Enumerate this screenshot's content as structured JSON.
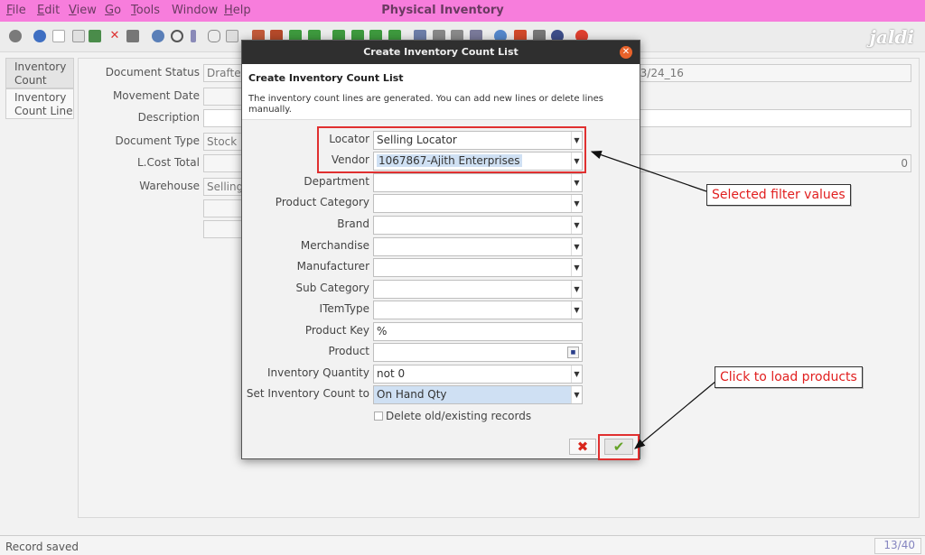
{
  "menubar": {
    "items": [
      {
        "pre": "",
        "u": "F",
        "post": "ile"
      },
      {
        "pre": "",
        "u": "E",
        "post": "dit"
      },
      {
        "pre": "",
        "u": "V",
        "post": "iew"
      },
      {
        "pre": "",
        "u": "G",
        "post": "o"
      },
      {
        "pre": "",
        "u": "T",
        "post": "ools"
      },
      {
        "pre": "Window",
        "u": "",
        "post": ""
      },
      {
        "pre": "",
        "u": "H",
        "post": "elp"
      }
    ],
    "title": "Physical Inventory"
  },
  "toolbar": {
    "logo_text": "jaldi",
    "icons": [
      "undo-icon",
      "help-icon",
      "new-icon",
      "copy-icon",
      "save-icon",
      "delete-icon",
      "grid-icon",
      "refresh-icon",
      "find-icon",
      "attachment-icon",
      "chat-icon",
      "history-icon",
      "home-icon",
      "parent-icon",
      "previous-icon",
      "next-icon",
      "first-icon",
      "up-icon",
      "down-icon",
      "last-icon",
      "report-icon",
      "archive-icon",
      "print-icon",
      "zoom-icon",
      "workflow-icon",
      "product-info-icon",
      "process-icon",
      "exit-icon"
    ]
  },
  "tabs": [
    {
      "label": "Inventory Count",
      "active": true
    },
    {
      "label": "Inventory Count Line",
      "active": false
    }
  ],
  "form": {
    "document_status_label": "Document Status",
    "document_status_value": "Drafted",
    "date_value": "13/24_16",
    "movement_date_label": "Movement Date",
    "description_label": "Description",
    "document_type_label": "Document Type",
    "document_type_value": "Stock U",
    "lcost_total_label": "L.Cost Total",
    "lcost_total_value": "0",
    "warehouse_label": "Warehouse",
    "warehouse_value": "Selling"
  },
  "dialog": {
    "window_title": "Create Inventory Count List",
    "header_title": "Create Inventory Count List",
    "header_desc": "The inventory count lines are generated. You can add new lines or delete lines manually.",
    "fields": {
      "locator": {
        "label": "Locator",
        "value": "Selling Locator"
      },
      "vendor": {
        "label": "Vendor",
        "value": "1067867-Ajith Enterprises"
      },
      "department": {
        "label": "Department",
        "value": ""
      },
      "product_category": {
        "label": "Product Category",
        "value": ""
      },
      "brand": {
        "label": "Brand",
        "value": ""
      },
      "merchandise": {
        "label": "Merchandise",
        "value": ""
      },
      "manufacturer": {
        "label": "Manufacturer",
        "value": ""
      },
      "sub_category": {
        "label": "Sub Category",
        "value": ""
      },
      "item_type": {
        "label": "ITemType",
        "value": ""
      },
      "product_key": {
        "label": "Product Key",
        "value": "%"
      },
      "product": {
        "label": "Product",
        "value": ""
      },
      "inventory_quantity": {
        "label": "Inventory Quantity",
        "value": "not 0"
      },
      "set_inventory_count_to": {
        "label": "Set Inventory Count to",
        "value": "On Hand Qty"
      }
    },
    "delete_records_label": "Delete old/existing records",
    "delete_records_checked": false,
    "cancel_symbol": "✖",
    "ok_symbol": "✔"
  },
  "annotations": {
    "selected_filter_values": "Selected filter values",
    "click_to_load_products": "Click to load products",
    "highlight_color": "#e03030"
  },
  "statusbar": {
    "message": "Record saved",
    "record_count": "13/40"
  }
}
